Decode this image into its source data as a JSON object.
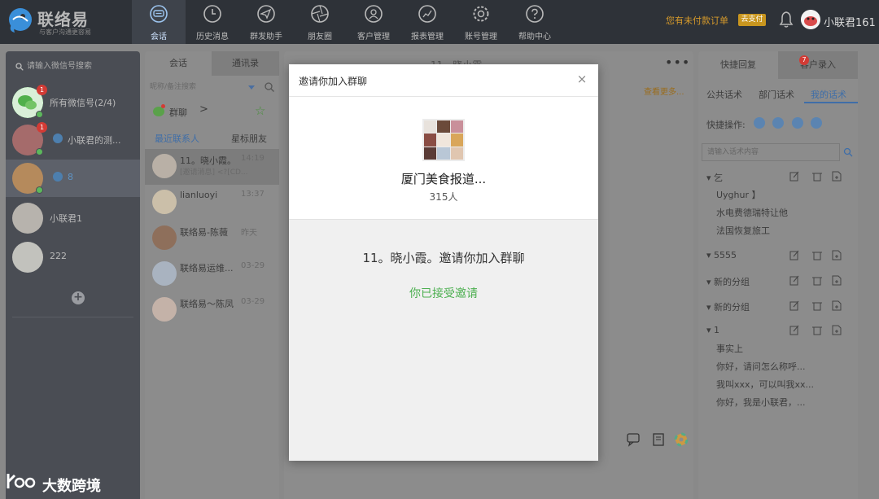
{
  "app": {
    "name": "联络易",
    "slogan": "与客户沟通更容易"
  },
  "nav": [
    {
      "label": "会话",
      "icon": "chat-bubble-icon",
      "active": true
    },
    {
      "label": "历史消息",
      "icon": "clock-icon"
    },
    {
      "label": "群发助手",
      "icon": "paper-plane-icon"
    },
    {
      "label": "朋友圈",
      "icon": "aperture-icon"
    },
    {
      "label": "客户管理",
      "icon": "person-icon"
    },
    {
      "label": "报表管理",
      "icon": "chart-icon"
    },
    {
      "label": "账号管理",
      "icon": "gear-icon"
    },
    {
      "label": "帮助中心",
      "icon": "question-icon"
    }
  ],
  "header": {
    "unpaid_notice": "您有未付款订单",
    "pay_label": "去支付",
    "user_name": "小联君161"
  },
  "accounts": {
    "search_placeholder": "请输入微信号搜索",
    "items": [
      {
        "label": "所有微信号(2/4)",
        "badge": "1"
      },
      {
        "label": "小联君的测...",
        "badge": "1"
      },
      {
        "label": "8"
      },
      {
        "label": "小联君1"
      },
      {
        "label": "222"
      }
    ]
  },
  "conversations": {
    "tabs": [
      "会话",
      "通讯录"
    ],
    "search_placeholder": "昵称/备注搜索",
    "group_label": "群聊",
    "group_arrow": ">",
    "sub_tabs": [
      "最近联系人",
      "星标朋友"
    ],
    "items": [
      {
        "name": "11。晓小霞。",
        "time": "14:19",
        "preview": "[邀请消息]  <?[CD..."
      },
      {
        "name": "lianluoyi",
        "time": "13:37",
        "preview": ""
      },
      {
        "name": "联络易-陈薇",
        "time": "昨天",
        "preview": ""
      },
      {
        "name": "联络易运维...",
        "time": "03-29",
        "preview": ""
      },
      {
        "name": "联络易～陈凤",
        "time": "03-29",
        "preview": ""
      }
    ]
  },
  "chat": {
    "title": "11。晓小霞",
    "more": "•••",
    "view_more": "查看更多..."
  },
  "right_panel": {
    "tabs": [
      "快捷回复",
      "客户录入"
    ],
    "tab_badge": "7",
    "sub_tabs": [
      "公共话术",
      "部门话术",
      "我的话术"
    ],
    "ops_label": "快捷操作:",
    "search_placeholder": "请输入话术内容",
    "groups": [
      {
        "title": "▾ 乞",
        "lines": [
          "Uyghur 】",
          "水电费德瑞特让他",
          "法国恢复旅工"
        ]
      },
      {
        "title": "▾ 5555",
        "lines": []
      },
      {
        "title": "▾ 新的分组",
        "lines": []
      },
      {
        "title": "▾ 新的分组",
        "lines": []
      },
      {
        "title": "▾ 1",
        "lines": [
          "事实上",
          "你好，请问怎么称呼...",
          "我叫xxx，可以叫我xx...",
          "你好，我是小联君，..."
        ]
      }
    ]
  },
  "modal": {
    "title": "邀请你加入群聊",
    "close": "×",
    "group_name": "厦门美食报道...",
    "member_count": "315人",
    "invite_text": "11。晓小霞。邀请你加入群聊",
    "accepted_text": "你已接受邀请"
  },
  "watermark": {
    "text": "大数跨境"
  },
  "colors": {
    "topbar": "#2e3238",
    "accent_blue": "#3f6ea8",
    "accepted_green": "#4caf50",
    "badge_red": "#d23b35",
    "pay_gold": "#c9961f"
  }
}
